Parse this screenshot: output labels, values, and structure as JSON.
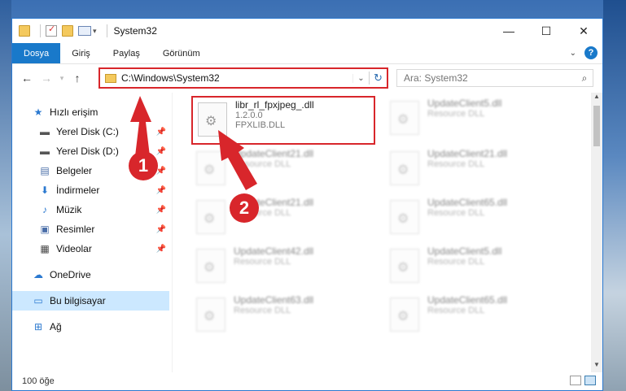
{
  "window": {
    "title": "System32",
    "controls": {
      "minimize": "—",
      "maximize": "☐",
      "close": "✕"
    }
  },
  "ribbon": {
    "tabs": [
      "Dosya",
      "Giriş",
      "Paylaş",
      "Görünüm"
    ]
  },
  "nav": {
    "address": "C:\\Windows\\System32",
    "search_placeholder": "Ara: System32"
  },
  "sidebar": {
    "items": [
      {
        "label": "Hızlı erişim",
        "icon": "star-icon"
      },
      {
        "label": "Yerel Disk (C:)",
        "icon": "drive-icon"
      },
      {
        "label": "Yerel Disk (D:)",
        "icon": "drive-icon"
      },
      {
        "label": "Belgeler",
        "icon": "documents-icon"
      },
      {
        "label": "İndirmeler",
        "icon": "download-icon"
      },
      {
        "label": "Müzik",
        "icon": "music-icon"
      },
      {
        "label": "Resimler",
        "icon": "pictures-icon"
      },
      {
        "label": "Videolar",
        "icon": "videos-icon"
      },
      {
        "label": "OneDrive",
        "icon": "cloud-icon"
      },
      {
        "label": "Bu bilgisayar",
        "icon": "computer-icon"
      },
      {
        "label": "Ağ",
        "icon": "network-icon"
      }
    ]
  },
  "files": [
    {
      "name": "libr_rl_fpxjpeg_.dll",
      "line2": "1.2.0.0",
      "line3": "FPXLIB.DLL"
    },
    {
      "name": "UpdateClient5.dll",
      "line2": "Resource DLL"
    },
    {
      "name": "UpdateClient21.dll",
      "line2": "Resource DLL"
    },
    {
      "name": "UpdateClient21.dll",
      "line2": "Resource DLL"
    },
    {
      "name": "UpdateClient21.dll",
      "line2": "Resource DLL"
    },
    {
      "name": "UpdateClient65.dll",
      "line2": "Resource DLL"
    },
    {
      "name": "UpdateClient42.dll",
      "line2": "Resource DLL"
    },
    {
      "name": "UpdateClient5.dll",
      "line2": "Resource DLL"
    },
    {
      "name": "UpdateClient63.dll",
      "line2": "Resource DLL"
    },
    {
      "name": "UpdateClient65.dll",
      "line2": "Resource DLL"
    }
  ],
  "status": {
    "item_count": "100 öğe"
  },
  "annotations": {
    "step1": "1",
    "step2": "2"
  },
  "colors": {
    "accent": "#1979ca",
    "highlight": "#d8262b",
    "selected": "#cce8ff"
  }
}
